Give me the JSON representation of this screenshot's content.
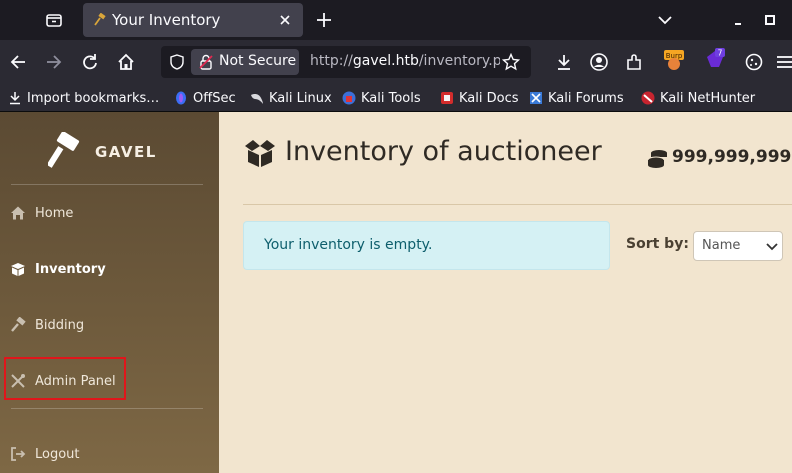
{
  "browser": {
    "tab_title": "Your Inventory",
    "url_security": "Not Secure",
    "url_prefix": "http://",
    "url_host": "gavel.htb",
    "url_path": "/inventory.p",
    "extension_badge": "7",
    "burp_label": "Burp"
  },
  "bookmarks": [
    {
      "label": "Import bookmarks…",
      "icon": "import-icon"
    },
    {
      "label": "OffSec",
      "icon": "offsec-icon"
    },
    {
      "label": "Kali Linux",
      "icon": "kali-dragon-icon"
    },
    {
      "label": "Kali Tools",
      "icon": "kali-tools-icon"
    },
    {
      "label": "Kali Docs",
      "icon": "kali-docs-icon"
    },
    {
      "label": "Kali Forums",
      "icon": "kali-forums-icon"
    },
    {
      "label": "Kali NetHunter",
      "icon": "nethunter-icon"
    }
  ],
  "sidebar": {
    "brand": "GAVEL",
    "items": [
      {
        "label": "Home",
        "icon": "home-icon"
      },
      {
        "label": "Inventory",
        "icon": "box-icon",
        "active": true
      },
      {
        "label": "Bidding",
        "icon": "hammer-icon"
      },
      {
        "label": "Admin Panel",
        "icon": "tools-icon",
        "highlighted": true
      },
      {
        "label": "Logout",
        "icon": "logout-icon"
      }
    ]
  },
  "main": {
    "title": "Inventory of auctioneer",
    "balance": "999,999,999",
    "empty_message": "Your inventory is empty.",
    "sort_label": "Sort by:",
    "sort_value": "Name"
  },
  "colors": {
    "highlight_box": "#e0161b",
    "alert_bg": "#d5f1f4",
    "page_bg": "#f2e5cf"
  }
}
